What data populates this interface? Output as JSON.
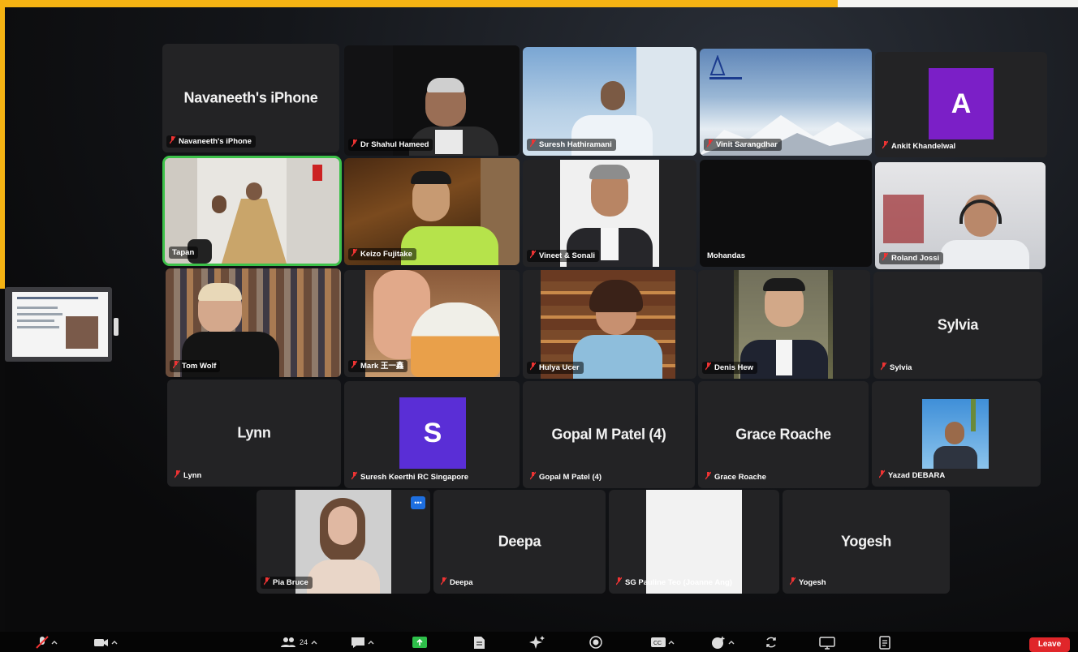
{
  "participants": {
    "navaneeth": {
      "center": "Navaneeth's iPhone",
      "label": "Navaneeth's iPhone"
    },
    "shahul": {
      "label": "Dr Shahul Hameed"
    },
    "suresh_h": {
      "label": "Suresh Hathiramani"
    },
    "vinit": {
      "label": "Vinit Sarangdhar"
    },
    "ankit": {
      "initial": "A",
      "label": "Ankit Khandelwal"
    },
    "tapan": {
      "label": "Tapan"
    },
    "keizo": {
      "label": "Keizo Fujitake"
    },
    "vineet": {
      "label": "Vineet & Sonali"
    },
    "mohandas": {
      "label": "Mohandas"
    },
    "roland": {
      "label": "Roland Jossi"
    },
    "tom": {
      "label": "Tom Wolf"
    },
    "mark": {
      "label": "Mark 王一鑫"
    },
    "hulya": {
      "label": "Hulya Ucer"
    },
    "denis": {
      "label": "Denis Hew"
    },
    "sylvia": {
      "center": "Sylvia",
      "label": "Sylvia"
    },
    "lynn": {
      "center": "Lynn",
      "label": "Lynn"
    },
    "suresh_k": {
      "initial": "S",
      "label": "Suresh Keerthi RC Singapore"
    },
    "gopal": {
      "center": "Gopal M Patel (4)",
      "label": "Gopal M Patel (4)"
    },
    "grace": {
      "center": "Grace Roache",
      "label": "Grace Roache"
    },
    "yazad": {
      "label": "Yazad DEBARA"
    },
    "pia": {
      "label": "Pia Bruce",
      "menu": "•••"
    },
    "deepa": {
      "center": "Deepa",
      "label": "Deepa"
    },
    "pauline": {
      "label": "SG Pauline Teo (Joanne Ang)"
    },
    "yogesh": {
      "center": "Yogesh",
      "label": "Yogesh"
    }
  },
  "toolbar": {
    "participants_count": "24",
    "leave_label": "Leave"
  },
  "colors": {
    "accent_yellow": "#f5b313",
    "active_speaker": "#3dc24a",
    "avatar_purple": "#7b1fc7",
    "avatar_blue_violet": "#5a2ed6",
    "leave_red": "#e0262a"
  }
}
